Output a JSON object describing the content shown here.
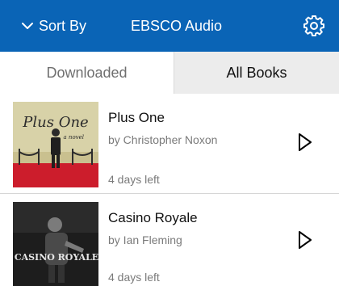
{
  "header": {
    "sort_label": "Sort By",
    "app_title": "EBSCO Audio",
    "sort_icon": "chevron-down-icon",
    "settings_icon": "gear-icon",
    "bg_color": "#0a64b6"
  },
  "tabs": [
    {
      "label": "Downloaded",
      "selected": false
    },
    {
      "label": "All Books",
      "selected": true
    }
  ],
  "books": [
    {
      "title": "Plus One",
      "author": "by Christopher Noxon",
      "due": "4 days left",
      "cover_title": "Plus One",
      "cover_subtitle": "a novel",
      "play_icon": "play-icon"
    },
    {
      "title": "Casino Royale",
      "author": "by Ian Fleming",
      "due": "4 days left",
      "cover_title": "CASINO ROYALE",
      "play_icon": "play-icon"
    }
  ]
}
